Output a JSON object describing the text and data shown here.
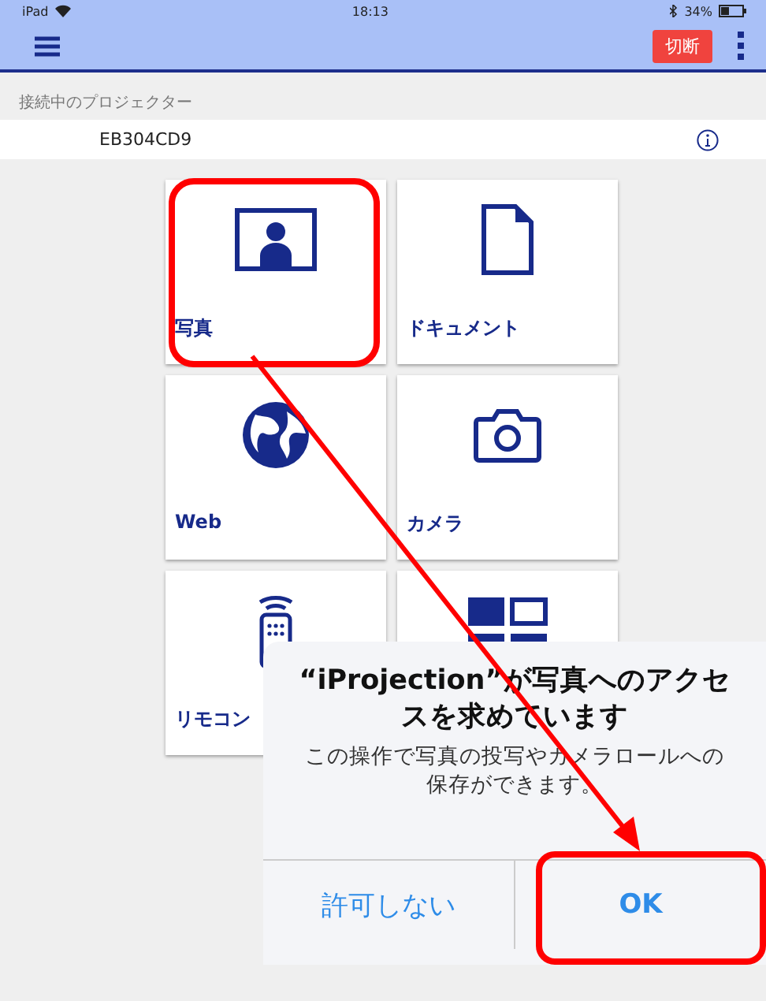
{
  "status_bar": {
    "device": "iPad",
    "time": "18:13",
    "battery": "34%"
  },
  "nav_bar": {
    "disconnect_button": "切断"
  },
  "section_header": "接続中のプロジェクター",
  "projector": {
    "name": "EB304CD9"
  },
  "tiles": [
    {
      "kind": "photo",
      "label": "写真"
    },
    {
      "kind": "document",
      "label": "ドキュメント"
    },
    {
      "kind": "web",
      "label": "Web"
    },
    {
      "kind": "camera",
      "label": "カメラ"
    },
    {
      "kind": "remote",
      "label": "リモコン"
    },
    {
      "kind": "layout"
    }
  ],
  "dialog": {
    "title": "“iProjection”が写真へのアクセスを求めています",
    "message": "この操作で写真の投写やカメラロールへの保存ができます。",
    "buttons": [
      {
        "label": "許可しない",
        "kind": "cancel"
      },
      {
        "label": "OK",
        "kind": "default"
      }
    ]
  }
}
